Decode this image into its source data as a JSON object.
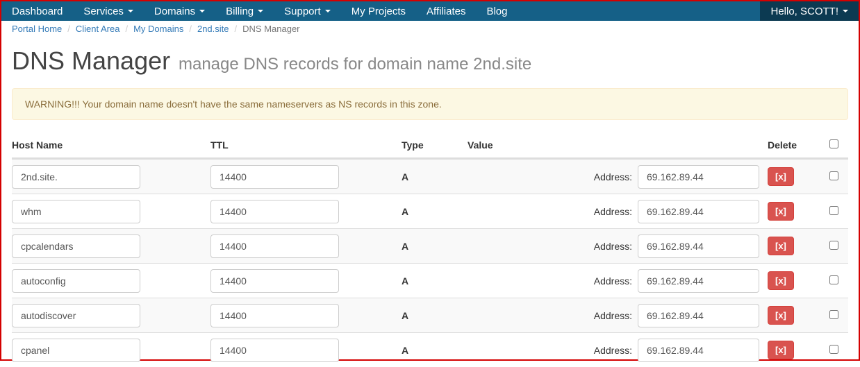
{
  "nav": {
    "items": [
      {
        "label": "Dashboard",
        "dropdown": false
      },
      {
        "label": "Services",
        "dropdown": true
      },
      {
        "label": "Domains",
        "dropdown": true
      },
      {
        "label": "Billing",
        "dropdown": true
      },
      {
        "label": "Support",
        "dropdown": true
      },
      {
        "label": "My Projects",
        "dropdown": false
      },
      {
        "label": "Affiliates",
        "dropdown": false
      },
      {
        "label": "Blog",
        "dropdown": false
      }
    ],
    "user_label": "Hello, SCOTT!"
  },
  "breadcrumb": {
    "items": [
      "Portal Home",
      "Client Area",
      "My Domains",
      "2nd.site"
    ],
    "active": "DNS Manager"
  },
  "header": {
    "title": "DNS Manager",
    "subtitle": "manage DNS records for domain name 2nd.site"
  },
  "alert": {
    "text": "WARNING!!! Your domain name doesn't have the same nameservers as NS records in this zone."
  },
  "table": {
    "columns": {
      "host": "Host Name",
      "ttl": "TTL",
      "type": "Type",
      "value": "Value",
      "delete": "Delete"
    },
    "address_label": "Address:",
    "delete_button": "[x]",
    "rows": [
      {
        "host": "2nd.site.",
        "ttl": "14400",
        "type": "A",
        "address": "69.162.89.44"
      },
      {
        "host": "whm",
        "ttl": "14400",
        "type": "A",
        "address": "69.162.89.44"
      },
      {
        "host": "cpcalendars",
        "ttl": "14400",
        "type": "A",
        "address": "69.162.89.44"
      },
      {
        "host": "autoconfig",
        "ttl": "14400",
        "type": "A",
        "address": "69.162.89.44"
      },
      {
        "host": "autodiscover",
        "ttl": "14400",
        "type": "A",
        "address": "69.162.89.44"
      },
      {
        "host": "cpanel",
        "ttl": "14400",
        "type": "A",
        "address": "69.162.89.44"
      }
    ]
  }
}
